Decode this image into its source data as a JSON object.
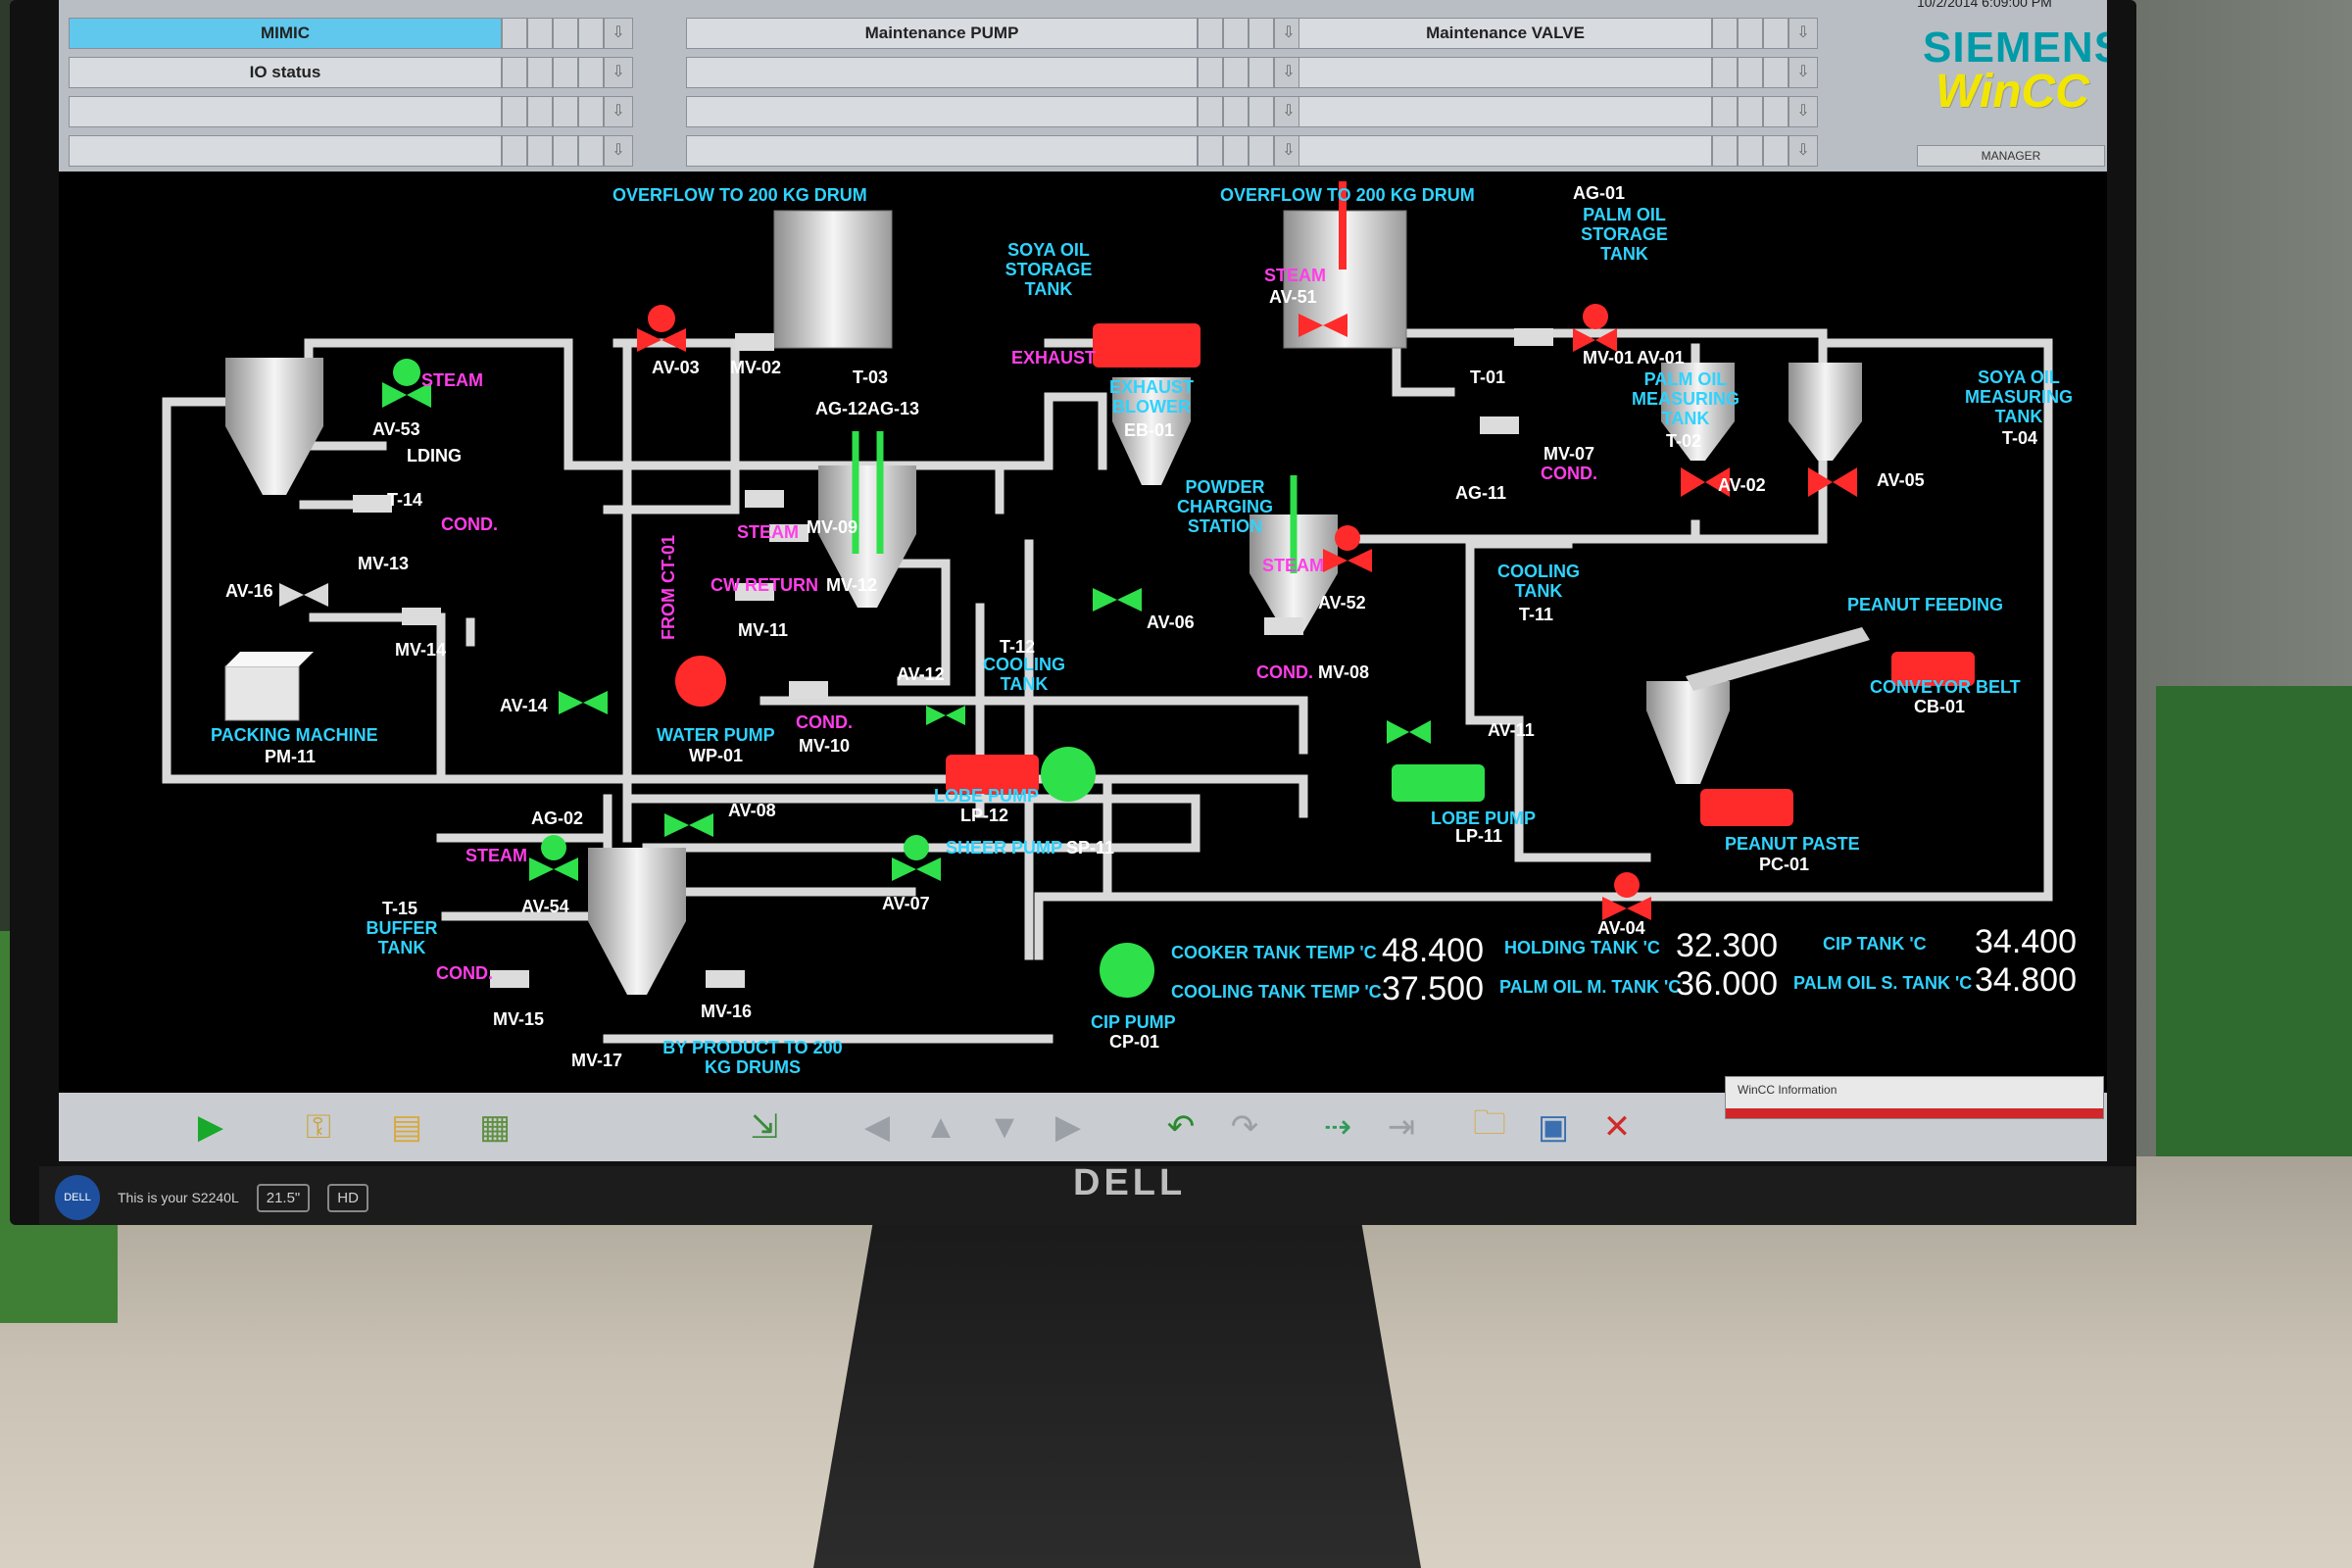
{
  "header": {
    "rows": [
      {
        "nav": "MIMIC",
        "pump": "Maintenance PUMP",
        "valve": "Maintenance VALVE"
      },
      {
        "nav": "IO status",
        "pump": "",
        "valve": ""
      },
      {
        "nav": "",
        "pump": "",
        "valve": ""
      },
      {
        "nav": "",
        "pump": "",
        "valve": ""
      }
    ],
    "clock": "10/2/2014 6:09:00 PM",
    "brand": "SIEMENS",
    "product": "WinCC",
    "user": "MANAGER"
  },
  "labels": {
    "overflow1": "OVERFLOW TO 200 KG DRUM",
    "overflow2": "OVERFLOW TO 200 KG DRUM",
    "soya_tank": "SOYA OIL STORAGE TANK",
    "t03": "T-03",
    "ag12": "AG-12",
    "ag13": "AG-13",
    "exhaust": "EXHAUST",
    "blower": "EXHAUST BLOWER",
    "eb01": "EB-01",
    "steam_av51": "STEAM",
    "av51": "AV-51",
    "ag01": "AG-01",
    "palm_tank": "PALM OIL STORAGE TANK",
    "t01": "T-01",
    "mv01": "MV-01",
    "av01": "AV-01",
    "palm_meas": "PALM OIL MEASURING TANK",
    "t02": "T-02",
    "soya_meas": "SOYA OIL MEASURING TANK",
    "t04": "T-04",
    "mv07": "MV-07",
    "cond_mv07": "COND.",
    "av02": "AV-02",
    "av05": "AV-05",
    "av03": "AV-03",
    "mv02": "MV-02",
    "steam_av53": "STEAM",
    "av53": "AV-53",
    "holding_partial": "LDING",
    "t14": "T-14",
    "cond_t14": "COND.",
    "mv13": "MV-13",
    "av16": "AV-16",
    "mv14": "MV-14",
    "packing": "PACKING MACHINE",
    "pm11": "PM-11",
    "av14": "AV-14",
    "powder": "POWDER CHARGING STATION",
    "ag11": "AG-11",
    "steam_mv09": "STEAM",
    "mv09": "MV-09",
    "cw_return": "CW RETURN",
    "mv12": "MV-12",
    "from_ct": "FROM CT-01",
    "mv11": "MV-11",
    "av12": "AV-12",
    "t12": "T-12",
    "cooling_t12": "COOLING TANK",
    "av06": "AV-06",
    "steam_av52": "STEAM",
    "av52": "AV-52",
    "cond_mv08": "COND.",
    "mv08": "MV-08",
    "cooling_t11": "COOLING TANK",
    "t11": "T-11",
    "peanut_feeding": "PEANUT FEEDING",
    "conveyor": "CONVEYOR BELT",
    "cb01": "CB-01",
    "water_pump": "WATER PUMP",
    "wp01": "WP-01",
    "cond_mv10": "COND.",
    "mv10": "MV-10",
    "lobe_lp12": "LOBE PUMP",
    "lp12": "LP-12",
    "av11": "AV-11",
    "lobe_lp11": "LOBE PUMP",
    "lp11": "LP-11",
    "peanut_paste": "PEANUT PASTE",
    "pc01": "PC-01",
    "ag02": "AG-02",
    "av08": "AV-08",
    "sheer": "SHEER PUMP",
    "sp11": "SP-11",
    "steam_av54": "STEAM",
    "av54": "AV-54",
    "av07": "AV-07",
    "t15": "T-15",
    "buffer": "BUFFER TANK",
    "cond_mv15": "COND.",
    "mv15": "MV-15",
    "mv16": "MV-16",
    "mv17": "MV-17",
    "byproduct": "BY PRODUCT TO 200 KG DRUMS",
    "cip_pump": "CIP PUMP",
    "cp01": "CP-01",
    "av04": "AV-04"
  },
  "readings": {
    "cooker_label": "COOKER TANK TEMP 'C",
    "cooker_value": "48.400",
    "cooling_label": "COOLING TANK TEMP 'C",
    "cooling_value": "37.500",
    "holding_label": "HOLDING TANK 'C",
    "holding_value": "32.300",
    "palm_m_label": "PALM OIL M. TANK 'C",
    "palm_m_value": "36.000",
    "cip_label": "CIP TANK 'C",
    "cip_value": "34.400",
    "palm_s_label": "PALM OIL S. TANK 'C",
    "palm_s_value": "34.800"
  },
  "popup": {
    "title": "WinCC Information"
  },
  "monitor": {
    "brand": "DELL",
    "badge_text": "This is your S2240L",
    "size": "21.5\"",
    "hd": "HD"
  },
  "colors": {
    "label_cyan": "#2fd3ff",
    "label_magenta": "#ff3ee8",
    "valve_open": "#2ee04a",
    "valve_closed": "#ff2a2a",
    "nav_active": "#5fc8ec"
  }
}
